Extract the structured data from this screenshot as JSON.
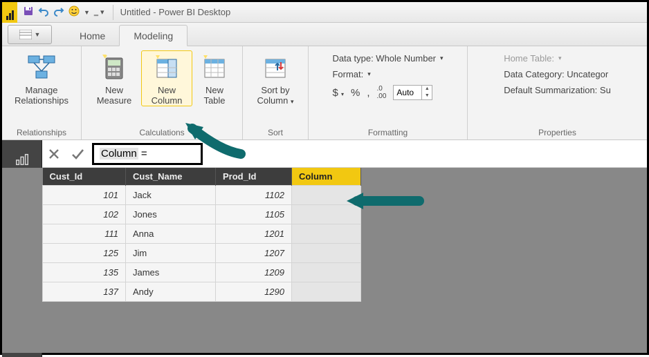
{
  "title": "Untitled - Power BI Desktop",
  "tabs": {
    "home": "Home",
    "modeling": "Modeling"
  },
  "ribbon": {
    "relationships": {
      "manage": "Manage\nRelationships",
      "group": "Relationships"
    },
    "calculations": {
      "newMeasure": "New\nMeasure",
      "newColumn": "New\nColumn",
      "newTable": "New\nTable",
      "group": "Calculations"
    },
    "sort": {
      "sortBy": "Sort by\nColumn",
      "group": "Sort"
    },
    "formatting": {
      "dataType": "Data type: Whole Number",
      "format": "Format:",
      "auto": "Auto",
      "group": "Formatting",
      "currency": "$",
      "percent": "%",
      "comma": ",",
      "decimals_ic": ".00"
    },
    "properties": {
      "homeTable": "Home Table:",
      "dataCategory": "Data Category: Uncategor",
      "defaultSum": "Default Summarization: Su",
      "group": "Properties"
    }
  },
  "formula": {
    "text": "Column =",
    "token": "Column"
  },
  "table": {
    "headers": [
      "Cust_Id",
      "Cust_Name",
      "Prod_Id",
      "Column"
    ],
    "rows": [
      {
        "cust_id": "101",
        "cust_name": "Jack",
        "prod_id": "1102"
      },
      {
        "cust_id": "102",
        "cust_name": "Jones",
        "prod_id": "1105"
      },
      {
        "cust_id": "111",
        "cust_name": "Anna",
        "prod_id": "1201"
      },
      {
        "cust_id": "125",
        "cust_name": "Jim",
        "prod_id": "1207"
      },
      {
        "cust_id": "135",
        "cust_name": "James",
        "prod_id": "1209"
      },
      {
        "cust_id": "137",
        "cust_name": "Andy",
        "prod_id": "1290"
      }
    ]
  }
}
